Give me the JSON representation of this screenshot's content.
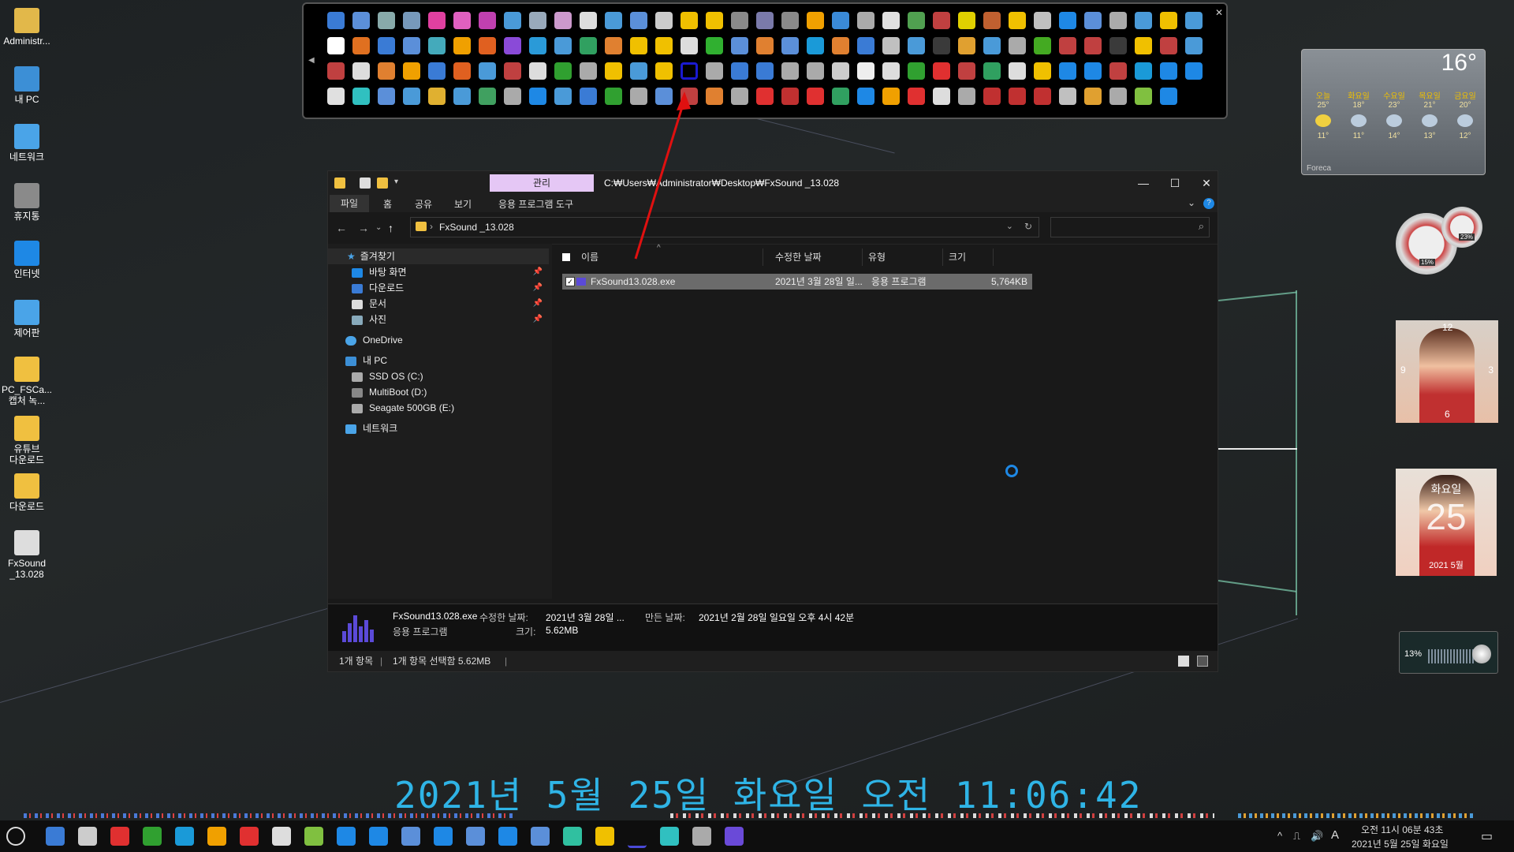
{
  "desktop_icons": [
    {
      "label": "Administr...",
      "color": "#e2b84a"
    },
    {
      "label": "내 PC",
      "color": "#3c8fd6"
    },
    {
      "label": "네트워크",
      "color": "#4aa4e8"
    },
    {
      "label": "휴지통",
      "color": "#8a8a8a"
    },
    {
      "label": "인터넷",
      "color": "#1e88e5"
    },
    {
      "label": "제어판",
      "color": "#4aa4e8"
    },
    {
      "label": "PC_FSCa...\n캡처 녹...",
      "color": "#f0c040"
    },
    {
      "label": "유튜브\n다운로드",
      "color": "#f0c040"
    },
    {
      "label": "다운로드",
      "color": "#f0c040"
    },
    {
      "label": "FxSound\n_13.028",
      "color": "#dddddd"
    }
  ],
  "launcher": {
    "icon_colors": [
      "#3a7bd5",
      "#5b8fd9",
      "#8aa",
      "#79b",
      "#e040a0",
      "#e060c0",
      "#c040b0",
      "#4a9ad8",
      "#9ab",
      "#c9c",
      "#ddd",
      "#4a9ad8",
      "#5b8fd9",
      "#ccc",
      "#f0c000",
      "#f0c000",
      "#8a8a8a",
      "#7a7aaa",
      "#8a8a8a",
      "#f0a000",
      "#3a8ad8",
      "#aaa",
      "#e0e0e0",
      "#50a050",
      "#c04040",
      "#e0d000",
      "#c06030",
      "#f0c000",
      "#c0c0c0",
      "#1e88e5",
      "#5b8fd9",
      "#aaa",
      "#4a9ad8",
      "#f0c000",
      "#4a9ad8",
      "#ffffff",
      "#e07020",
      "#3a7bd5",
      "#5b8fd9",
      "#4ab",
      "#f0a000",
      "#e06020",
      "#8a4ad8",
      "#2a9ad8",
      "#4a9ad8",
      "#30a060",
      "#e08030",
      "#f0c000",
      "#f0c000",
      "#ddd",
      "#30b030",
      "#5b8fd9",
      "#e08030",
      "#5b8fd9",
      "#1a9ad8",
      "#e08030",
      "#3a7bd5",
      "#c0c0c0",
      "#4a9ad8",
      "#3a3a3a",
      "#e0a030",
      "#4a9ad8",
      "#aaa",
      "#4a2",
      "#c04040",
      "#c04040",
      "#3a3a3a",
      "#f0c000",
      "#c04040",
      "#4a9ad8",
      "#c04040",
      "#ddd",
      "#e08030",
      "#f0a000",
      "#3a7bd5",
      "#e06020",
      "#4a9ad8",
      "#c04040",
      "#ddd",
      "#30a030",
      "#aaa",
      "#f0c000",
      "#4a9ad8",
      "#f0c000",
      "SEL",
      "#aaa",
      "#3a7bd5",
      "#3a7bd5",
      "#aaa",
      "#aaa",
      "#ccc",
      "#eee",
      "#ddd",
      "#30a030",
      "#e03030",
      "#c04040",
      "#30a060",
      "#ddd",
      "#f0c000",
      "#1e88e5",
      "#1e88e5",
      "#c04040",
      "#1a9ad8",
      "#1e88e5",
      "#1e88e5",
      "#e0e0e0",
      "#30c0c0",
      "#5b8fd9",
      "#4a9ad8",
      "#e0b030",
      "#4a9ad8",
      "#40a060",
      "#aaa",
      "#1e88e5",
      "#4a9ad8",
      "#3a7bd5",
      "#30a030",
      "#aaa",
      "#5b8fd9",
      "#c04040",
      "#e08030",
      "#aaa",
      "#e03030",
      "#c03030",
      "#e03030",
      "#30a060",
      "#1e88e5",
      "#f0a000",
      "#e03030",
      "#ddd",
      "#aaa",
      "#c03030",
      "#c03030",
      "#c03030",
      "#c0c0c0",
      "#e0a030",
      "#aaa",
      "#80c040",
      "#1e88e5"
    ]
  },
  "explorer": {
    "manage_tab": "관리",
    "title_path": "C:₩Users₩Administrator₩Desktop₩FxSound _13.028",
    "ribbon_tabs": [
      "파일",
      "홈",
      "공유",
      "보기",
      "응용 프로그램 도구"
    ],
    "address": "FxSound _13.028",
    "search_placeholder": "",
    "nav": {
      "quick_access": "즐겨찾기",
      "items": [
        "바탕 화면",
        "다운로드",
        "문서",
        "사진"
      ],
      "onedrive": "OneDrive",
      "this_pc": "내 PC",
      "drives": [
        "SSD OS (C:)",
        "MultiBoot (D:)",
        "Seagate 500GB (E:)"
      ],
      "network": "네트워크"
    },
    "columns": [
      "이름",
      "수정한 날짜",
      "유형",
      "크기"
    ],
    "file": {
      "name": "FxSound13.028.exe",
      "modified": "2021년 3월 28일 일...",
      "type": "응용 프로그램",
      "size": "5,764KB"
    },
    "details": {
      "line1_name": "FxSound13.028.exe",
      "modified_label": "수정한 날짜:",
      "modified_value": "2021년 3월 28일 ...",
      "created_label": "만든 날짜:",
      "created_value": "2021년 2월 28일 일요일 오후 4시 42분",
      "type": "응용 프로그램",
      "size_label": "크기:",
      "size_value": "5.62MB"
    },
    "status": {
      "count": "1개 항목",
      "selected": "1개 항목 선택함 5.62MB"
    }
  },
  "weather": {
    "temp": "16°",
    "days": [
      "오늘",
      "화요일",
      "수요일",
      "목요일",
      "금요일"
    ],
    "highs": [
      "25°",
      "18°",
      "23°",
      "21°",
      "20°"
    ],
    "lows": [
      "11°",
      "11°",
      "14°",
      "13°",
      "12°"
    ],
    "footer": "Foreca"
  },
  "meters": {
    "cpu": "15%",
    "mem": "23%"
  },
  "calendar": {
    "weekday": "화요일",
    "day": "25",
    "month": "2021 5월"
  },
  "clock_face": {
    "n12": "12",
    "n3": "3",
    "n6": "6",
    "n9": "9"
  },
  "volume": {
    "level": "13%"
  },
  "big_clock": "2021년 5월 25일 화요일 오전 11:06:42",
  "taskbar": {
    "time": "오전 11시 06분 43초",
    "date": "2021년 5월 25일 화요일",
    "ime": "A",
    "icon_colors": [
      "#3a7bd5",
      "#ccc",
      "#e03030",
      "#30a030",
      "#1a9ad8",
      "#f0a000",
      "#e03030",
      "#ddd",
      "#80c040",
      "#1e88e5",
      "#1e88e5",
      "#5b8fd9",
      "#1e88e5",
      "#5b8fd9",
      "#1e88e5",
      "#5b8fd9",
      "#30c0a0",
      "#f0c000",
      "#4a4ad8",
      "#30c0c0",
      "#aaa",
      "#6a4ad8"
    ]
  }
}
